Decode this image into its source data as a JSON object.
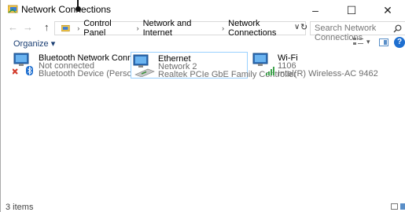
{
  "window": {
    "title": "Network Connections",
    "minimize_glyph": "–",
    "maximize_glyph": "☐",
    "close_glyph": "✕"
  },
  "nav": {
    "back_glyph": "←",
    "forward_glyph": "→",
    "up_glyph": "↑",
    "breadcrumb": [
      "Control Panel",
      "Network and Internet",
      "Network Connections"
    ],
    "separator": "›",
    "dropdown_glyph": "∨",
    "refresh_glyph": "↻"
  },
  "search": {
    "placeholder": "Search Network Connections",
    "icon": "search-icon"
  },
  "toolbar": {
    "organize_label": "Organize ▾",
    "help_label": "?"
  },
  "items": [
    {
      "name": "Bluetooth Network Connection",
      "status": "Not connected",
      "device": "Bluetooth Device (Personal Area ...",
      "icon": "bluetooth-network-icon"
    },
    {
      "name": "Ethernet",
      "status": "Network 2",
      "device": "Realtek PCIe GbE Family Controller",
      "icon": "ethernet-icon"
    },
    {
      "name": "Wi-Fi",
      "status": "1106",
      "device": "Intel(R) Wireless-AC 9462",
      "icon": "wifi-icon"
    }
  ],
  "statusbar": {
    "count": "3 items"
  },
  "colors": {
    "accent": "#1e6fd0",
    "selection_border": "#99d1ff"
  }
}
